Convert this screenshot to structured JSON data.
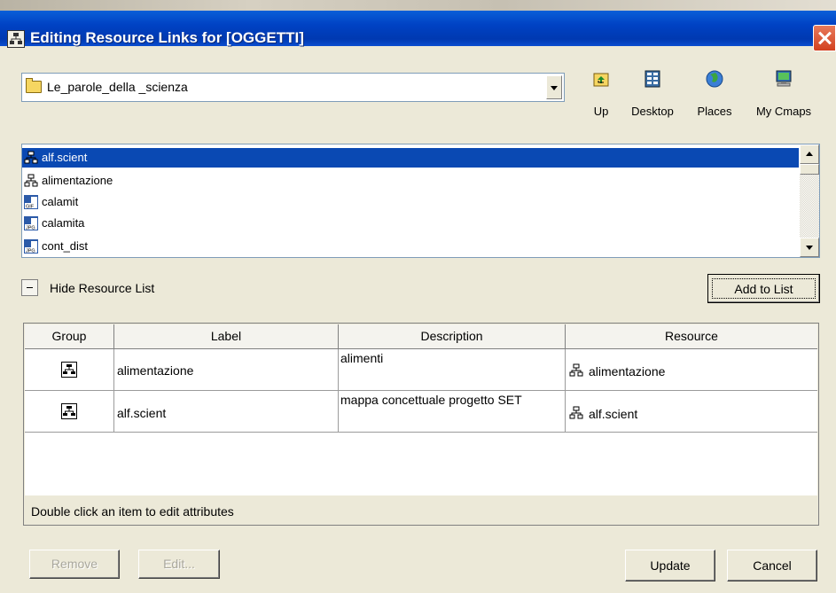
{
  "window": {
    "title": "Editing Resource Links for [OGGETTI]"
  },
  "folder_combo": {
    "value": "Le_parole_della _scienza"
  },
  "nav": [
    {
      "label": "Up",
      "icon": "folder-up-icon"
    },
    {
      "label": "Desktop",
      "icon": "desktop-icon"
    },
    {
      "label": "Places",
      "icon": "globe-icon"
    },
    {
      "label": "My Cmaps",
      "icon": "computer-icon"
    }
  ],
  "files": [
    {
      "name": "alf.scient",
      "icon": "cmap-icon",
      "selected": true
    },
    {
      "name": "alimentazione",
      "icon": "cmap-icon",
      "selected": false
    },
    {
      "name": "calamit",
      "icon": "gif-image-icon",
      "selected": false
    },
    {
      "name": "calamita",
      "icon": "jpg-image-icon",
      "selected": false
    },
    {
      "name": "cont_dist",
      "icon": "jpg-image-icon",
      "selected": false
    }
  ],
  "hide_resource_list": "Hide Resource List",
  "add_to_list": "Add to List",
  "table": {
    "headers": {
      "group": "Group",
      "label": "Label",
      "description": "Description",
      "resource": "Resource"
    },
    "rows": [
      {
        "label": "alimentazione",
        "description": "alimenti",
        "resource": "alimentazione"
      },
      {
        "label": "alf.scient",
        "description": "mappa concettuale progetto SET",
        "resource": "alf.scient"
      }
    ],
    "status": "Double click an item to edit attributes"
  },
  "buttons": {
    "remove": "Remove",
    "edit": "Edit...",
    "update": "Update",
    "cancel": "Cancel"
  },
  "colors": {
    "title_bar": "#0042c4",
    "selection": "#0a49b3",
    "dialog_bg": "#ece9d8"
  }
}
